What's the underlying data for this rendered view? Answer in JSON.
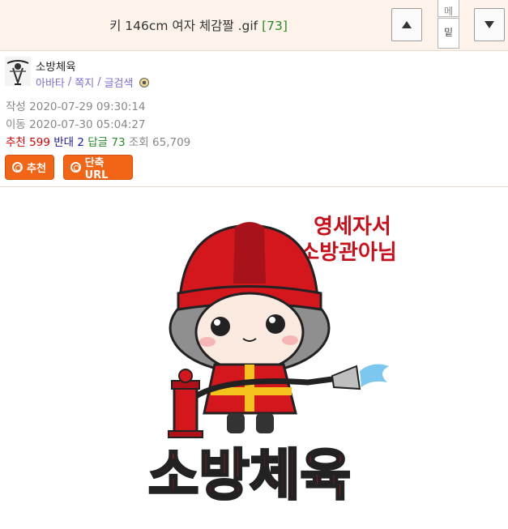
{
  "header": {
    "title": "키 146cm 여자 체감짤 .gif",
    "comment_count": "[73]",
    "mini_tab_top": "메",
    "mini_tab_bottom": "밑"
  },
  "author": {
    "name": "소방체육",
    "links": [
      "아바타",
      "쪽지",
      "글검색"
    ],
    "link_sep": "/"
  },
  "meta": {
    "created_label": "작성",
    "created_value": "2020-07-29 09:30:14",
    "moved_label": "이동",
    "moved_value": "2020-07-30 05:04:27",
    "recommend_label": "추천",
    "recommend_value": "599",
    "oppose_label": "반대",
    "oppose_value": "2",
    "reply_label": "답글",
    "reply_value": "73",
    "views_label": "조회",
    "views_value": "65,709"
  },
  "actions": {
    "recommend_label": "추천",
    "short_url_label": "단축URL"
  },
  "sticker": {
    "caption_line1": "영세자서",
    "caption_line2": "소방관아님",
    "big_text": "소방체육"
  },
  "colors": {
    "header_bg": "#fdf3ea",
    "accent_orange": "#f26416",
    "red": "#d00000",
    "blue": "#1a1aa8",
    "green": "#2a8a2a",
    "link_purple": "#7b6fd3"
  },
  "icons": {
    "up": "triangle-up-icon",
    "down": "triangle-down-icon",
    "level": "level-badge-icon",
    "button": "circle-icon"
  }
}
